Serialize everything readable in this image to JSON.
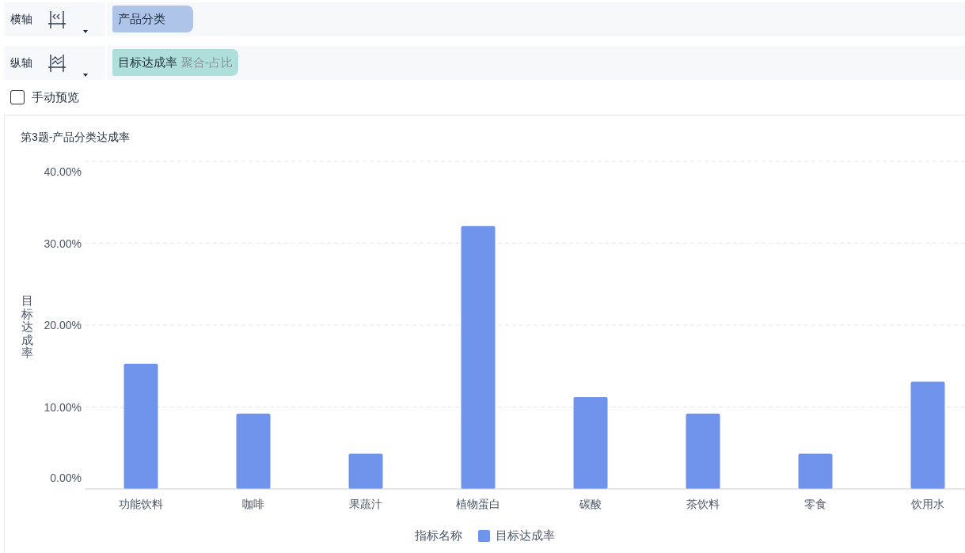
{
  "axes": [
    {
      "kind": "x",
      "label": "横轴",
      "field": {
        "name": "产品分类"
      }
    },
    {
      "kind": "y",
      "label": "纵轴",
      "field": {
        "name": "目标达成率",
        "aggregation": "聚合-占比"
      }
    }
  ],
  "manual_preview": {
    "label": "手动预览",
    "checked": false
  },
  "chart": {
    "legend_title": "指标名称",
    "chart_data": {
      "type": "bar",
      "title": "第3题-产品分类达成率",
      "ylabel": "目标达成率",
      "categories": [
        "功能饮料",
        "咖啡",
        "果蔬汁",
        "植物蛋白",
        "碳酸",
        "茶饮料",
        "零食",
        "饮用水"
      ],
      "series": [
        {
          "name": "目标达成率",
          "color": "#7093eb",
          "values": [
            15.3,
            9.2,
            4.3,
            32.1,
            11.2,
            9.2,
            4.3,
            13.1
          ]
        }
      ],
      "grid": true,
      "ylim": [
        0,
        40
      ],
      "yticks": [
        {
          "value": 0,
          "label": "0.00%"
        },
        {
          "value": 10,
          "label": "10.00%"
        },
        {
          "value": 20,
          "label": "20.00%"
        },
        {
          "value": 30,
          "label": "30.00%"
        },
        {
          "value": 40,
          "label": "40.00%"
        }
      ]
    }
  }
}
